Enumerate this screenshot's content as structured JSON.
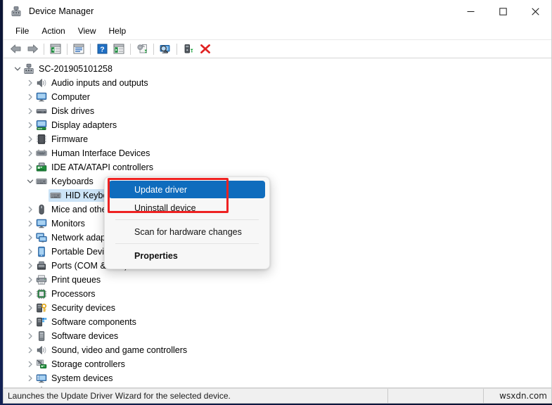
{
  "window": {
    "title": "Device Manager",
    "app_icon": "device-manager-icon",
    "controls": {
      "minimize": "─",
      "maximize": "☐",
      "close": "✕"
    }
  },
  "menubar": {
    "items": [
      {
        "label": "File",
        "name": "menu-file"
      },
      {
        "label": "Action",
        "name": "menu-action"
      },
      {
        "label": "View",
        "name": "menu-view"
      },
      {
        "label": "Help",
        "name": "menu-help"
      }
    ]
  },
  "toolbar": {
    "buttons": [
      {
        "name": "back-icon",
        "title": "Back"
      },
      {
        "name": "forward-icon",
        "title": "Forward"
      },
      {
        "sep": true
      },
      {
        "name": "show-hide-console-tree-icon",
        "title": "Show/Hide Console Tree"
      },
      {
        "sep": true
      },
      {
        "name": "properties-icon",
        "title": "Properties"
      },
      {
        "sep": true
      },
      {
        "name": "help-icon",
        "title": "Help"
      },
      {
        "name": "view-list-icon",
        "title": "View"
      },
      {
        "sep": true
      },
      {
        "name": "update-driver-icon",
        "title": "Update driver"
      },
      {
        "sep": true
      },
      {
        "name": "scan-hardware-changes-icon",
        "title": "Scan for hardware changes"
      },
      {
        "sep": true
      },
      {
        "name": "enable-device-icon",
        "title": "Enable device"
      },
      {
        "name": "uninstall-device-icon",
        "title": "Uninstall device"
      }
    ]
  },
  "tree": {
    "root": {
      "label": "SC-201905101258",
      "icon": "computer-root-icon",
      "expanded": true,
      "indent": 0
    },
    "items": [
      {
        "label": "Audio inputs and outputs",
        "icon": "speaker-icon",
        "expander": "collapsed",
        "indent": 1
      },
      {
        "label": "Computer",
        "icon": "monitor-icon",
        "expander": "collapsed",
        "indent": 1
      },
      {
        "label": "Disk drives",
        "icon": "disk-drive-icon",
        "expander": "collapsed",
        "indent": 1
      },
      {
        "label": "Display adapters",
        "icon": "display-adapter-icon",
        "expander": "collapsed",
        "indent": 1
      },
      {
        "label": "Firmware",
        "icon": "firmware-chip-icon",
        "expander": "collapsed",
        "indent": 1
      },
      {
        "label": "Human Interface Devices",
        "icon": "hid-icon",
        "expander": "collapsed",
        "indent": 1
      },
      {
        "label": "IDE ATA/ATAPI controllers",
        "icon": "ide-controller-icon",
        "expander": "collapsed",
        "indent": 1
      },
      {
        "label": "Keyboards",
        "icon": "keyboard-icon",
        "expander": "expanded",
        "indent": 1
      },
      {
        "label": "HID Keyboard Device",
        "icon": "keyboard-icon",
        "expander": "none",
        "indent": 2,
        "selected": true
      },
      {
        "label": "Mice and other pointing devices",
        "icon": "mouse-icon",
        "expander": "collapsed",
        "indent": 1
      },
      {
        "label": "Monitors",
        "icon": "monitor-icon",
        "expander": "collapsed",
        "indent": 1
      },
      {
        "label": "Network adapters",
        "icon": "network-adapter-icon",
        "expander": "collapsed",
        "indent": 1
      },
      {
        "label": "Portable Devices",
        "icon": "portable-device-icon",
        "expander": "collapsed",
        "indent": 1
      },
      {
        "label": "Ports (COM & LPT)",
        "icon": "port-icon",
        "expander": "collapsed",
        "indent": 1
      },
      {
        "label": "Print queues",
        "icon": "printer-icon",
        "expander": "collapsed",
        "indent": 1
      },
      {
        "label": "Processors",
        "icon": "processor-icon",
        "expander": "collapsed",
        "indent": 1
      },
      {
        "label": "Security devices",
        "icon": "security-device-icon",
        "expander": "collapsed",
        "indent": 1
      },
      {
        "label": "Software components",
        "icon": "software-component-icon",
        "expander": "collapsed",
        "indent": 1
      },
      {
        "label": "Software devices",
        "icon": "software-device-icon",
        "expander": "collapsed",
        "indent": 1
      },
      {
        "label": "Sound, video and game controllers",
        "icon": "speaker-icon",
        "expander": "collapsed",
        "indent": 1
      },
      {
        "label": "Storage controllers",
        "icon": "storage-controller-icon",
        "expander": "collapsed",
        "indent": 1
      },
      {
        "label": "System devices",
        "icon": "system-device-icon",
        "expander": "collapsed",
        "indent": 1
      },
      {
        "label": "Universal Serial Bus controllers",
        "icon": "usb-icon",
        "expander": "collapsed",
        "indent": 1
      }
    ]
  },
  "context_menu": {
    "items": [
      {
        "label": "Update driver",
        "name": "ctx-update-driver",
        "highlighted": true,
        "bold": false
      },
      {
        "label": "Uninstall device",
        "name": "ctx-uninstall-device",
        "highlighted": false,
        "bold": false
      },
      {
        "divider": true
      },
      {
        "label": "Scan for hardware changes",
        "name": "ctx-scan-hardware-changes",
        "highlighted": false,
        "bold": false
      },
      {
        "divider": true
      },
      {
        "label": "Properties",
        "name": "ctx-properties",
        "highlighted": false,
        "bold": true
      }
    ]
  },
  "annotation": {
    "color": "#ee2222"
  },
  "statusbar": {
    "text": "Launches the Update Driver Wizard for the selected device.",
    "pane2": "",
    "watermark": "wsxdn.com"
  },
  "colors": {
    "menu_highlight": "#0f6cbd",
    "tree_selection": "#cce4f7",
    "annotation_red": "#ee2222"
  }
}
